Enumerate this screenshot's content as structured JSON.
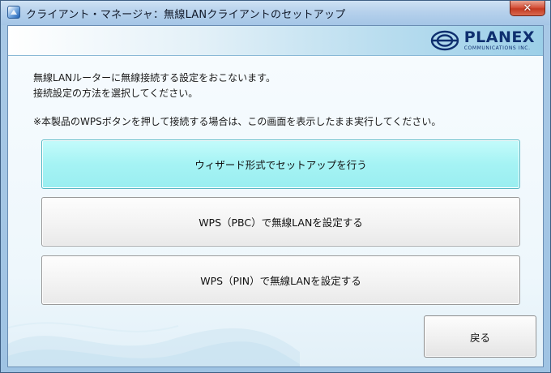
{
  "window": {
    "title": "クライアント・マネージャ：無線LANクライアントのセットアップ",
    "close_label": "✕",
    "icon": "app-icon"
  },
  "brand": {
    "name": "PLANEX",
    "tagline": "COMMUNICATIONS INC.",
    "logo_color": "#0f2f6f"
  },
  "instructions": {
    "line1": "無線LANルーターに無線接続する設定をおこないます。",
    "line2": "接続設定の方法を選択してください。",
    "note": "※本製品のWPSボタンを押して接続する場合は、この画面を表示したまま実行してください。"
  },
  "options": [
    {
      "label": "ウィザード形式でセットアップを行う",
      "selected": true
    },
    {
      "label": "WPS（PBC）で無線LANを設定する",
      "selected": false
    },
    {
      "label": "WPS（PIN）で無線LANを設定する",
      "selected": false
    }
  ],
  "footer": {
    "back_label": "戻る"
  },
  "colors": {
    "selected_button": "#a5f3f4",
    "titlebar": "#b6d1ec",
    "close_button": "#d7553e"
  }
}
